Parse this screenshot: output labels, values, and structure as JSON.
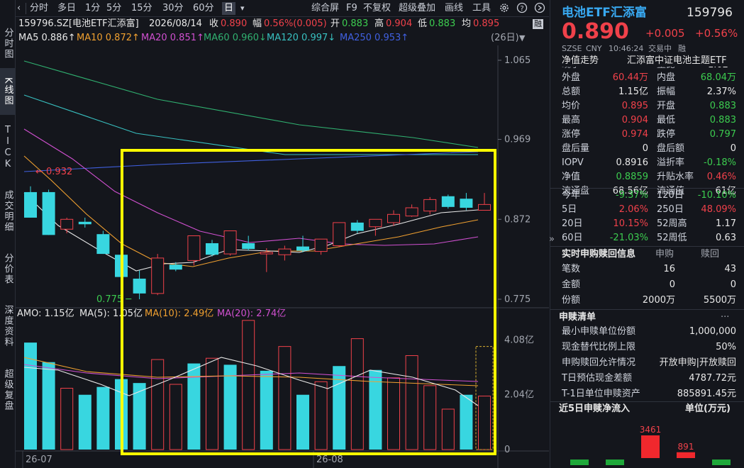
{
  "left_tabs": [
    "分时图",
    "K线图",
    "TICK",
    "成交明细",
    "分价表",
    "深度资料",
    "超级复盘"
  ],
  "toolbar": {
    "nav_left": "‹",
    "nav_right": "›",
    "periods": [
      "分时",
      "多日",
      "1分",
      "5分",
      "15分",
      "30分",
      "60分",
      "日"
    ],
    "period_dropdown": "▾",
    "actions": [
      "综合屏",
      "F9",
      "不复权",
      "超级叠加",
      "画线",
      "工具"
    ],
    "icons": [
      "gear-icon",
      "help-icon",
      "collapse-icon"
    ]
  },
  "info": {
    "symbol": "159796.SZ[电池ETF汇添富]",
    "date": "2026/08/14",
    "close_label": "收",
    "close": "0.890",
    "change_label": "幅",
    "change": "0.56%(0.005)",
    "open_label": "开",
    "open": "0.883",
    "high_label": "高",
    "high": "0.904",
    "low_label": "低",
    "low": "0.883",
    "avg_label": "均",
    "avg": "0.895",
    "badge": "融"
  },
  "ma": {
    "ma5": "MA5 0.886↑",
    "ma10": "MA10 0.872↑",
    "ma20": "MA20 0.851↑",
    "ma60": "MA60 0.960↓",
    "ma120": "MA120 0.997↓",
    "ma250": "MA250 0.953↑",
    "range": "(26日)"
  },
  "colors": {
    "up": "#f0414a",
    "down": "#38d6e0",
    "ma5": "#e8e8e8",
    "ma10": "#f0a030",
    "ma20": "#d050d0",
    "ma60": "#30b070",
    "ma120": "#38c0c0",
    "ma250": "#4060e0",
    "highlight": "#ffff00"
  },
  "chart_data": {
    "type": "candlestick",
    "price_ticks": [
      "1.065",
      "0.969",
      "0.872",
      "0.775"
    ],
    "volume_ticks": [
      "4.08亿",
      "2.04亿",
      "0"
    ],
    "x_ticks": [
      "26-07",
      "26-08"
    ],
    "annotations": {
      "high_mark": "0.932",
      "low_mark": "0.775"
    },
    "candles": [
      {
        "o": 0.905,
        "h": 0.912,
        "l": 0.874,
        "c": 0.874
      },
      {
        "o": 0.905,
        "h": 0.908,
        "l": 0.853,
        "c": 0.853
      },
      {
        "o": 0.86,
        "h": 0.874,
        "l": 0.855,
        "c": 0.872
      },
      {
        "o": 0.869,
        "h": 0.874,
        "l": 0.862,
        "c": 0.866
      },
      {
        "o": 0.854,
        "h": 0.858,
        "l": 0.83,
        "c": 0.83
      },
      {
        "o": 0.829,
        "h": 0.835,
        "l": 0.802,
        "c": 0.802
      },
      {
        "o": 0.8,
        "h": 0.81,
        "l": 0.775,
        "c": 0.782
      },
      {
        "o": 0.782,
        "h": 0.83,
        "l": 0.78,
        "c": 0.825
      },
      {
        "o": 0.817,
        "h": 0.82,
        "l": 0.809,
        "c": 0.811
      },
      {
        "o": 0.822,
        "h": 0.852,
        "l": 0.816,
        "c": 0.852
      },
      {
        "o": 0.843,
        "h": 0.847,
        "l": 0.827,
        "c": 0.829
      },
      {
        "o": 0.83,
        "h": 0.858,
        "l": 0.828,
        "c": 0.858
      },
      {
        "o": 0.843,
        "h": 0.852,
        "l": 0.834,
        "c": 0.836
      },
      {
        "o": 0.83,
        "h": 0.837,
        "l": 0.808,
        "c": 0.832
      },
      {
        "o": 0.829,
        "h": 0.84,
        "l": 0.822,
        "c": 0.836
      },
      {
        "o": 0.839,
        "h": 0.852,
        "l": 0.832,
        "c": 0.834
      },
      {
        "o": 0.833,
        "h": 0.848,
        "l": 0.829,
        "c": 0.848
      },
      {
        "o": 0.84,
        "h": 0.868,
        "l": 0.838,
        "c": 0.868
      },
      {
        "o": 0.868,
        "h": 0.871,
        "l": 0.855,
        "c": 0.858
      },
      {
        "o": 0.863,
        "h": 0.872,
        "l": 0.852,
        "c": 0.872
      },
      {
        "o": 0.868,
        "h": 0.883,
        "l": 0.864,
        "c": 0.878
      },
      {
        "o": 0.876,
        "h": 0.89,
        "l": 0.875,
        "c": 0.886
      },
      {
        "o": 0.882,
        "h": 0.899,
        "l": 0.878,
        "c": 0.896
      },
      {
        "o": 0.9,
        "h": 0.902,
        "l": 0.885,
        "c": 0.887
      },
      {
        "o": 0.897,
        "h": 0.904,
        "l": 0.883,
        "c": 0.886
      },
      {
        "o": 0.883,
        "h": 0.904,
        "l": 0.883,
        "c": 0.89
      }
    ],
    "volumes": [
      {
        "v": 4.1,
        "up": false
      },
      {
        "v": 3.35,
        "up": false
      },
      {
        "v": 2.35,
        "up": true
      },
      {
        "v": 2.1,
        "up": false
      },
      {
        "v": 2.4,
        "up": false
      },
      {
        "v": 2.7,
        "up": false
      },
      {
        "v": 2.55,
        "up": false
      },
      {
        "v": 3.45,
        "up": true
      },
      {
        "v": 2.5,
        "up": true
      },
      {
        "v": 3.3,
        "up": false
      },
      {
        "v": 3.5,
        "up": true
      },
      {
        "v": 3.25,
        "up": false
      },
      {
        "v": 4.95,
        "up": true
      },
      {
        "v": 3.02,
        "up": false
      },
      {
        "v": 3.95,
        "up": true
      },
      {
        "v": 2.1,
        "up": false
      },
      {
        "v": 2.6,
        "up": true
      },
      {
        "v": 3.2,
        "up": false
      },
      {
        "v": 4.25,
        "up": true
      },
      {
        "v": 3.05,
        "up": false
      },
      {
        "v": 2.75,
        "up": true
      },
      {
        "v": 3.6,
        "up": true
      },
      {
        "v": 2.45,
        "up": true
      },
      {
        "v": 1.55,
        "up": true
      },
      {
        "v": 2.1,
        "up": false
      },
      {
        "v": 2.05,
        "up": true
      }
    ],
    "volume_max": 5.0,
    "amo": {
      "label": "AMO: 1.15亿",
      "ma5": "MA(5): 1.05亿",
      "ma10": "MA(10): 2.49亿",
      "ma20": "MA(20): 2.74亿"
    }
  },
  "right": {
    "title": "电池ETF汇添富",
    "code": "159796",
    "price": "0.890",
    "chg": "+0.005",
    "chg_pct": "+0.56%",
    "sub": {
      "exchange": "SZSE",
      "currency": "CNY",
      "time": "10:46:24",
      "status": "交易中",
      "badge": "融"
    },
    "nav_trend": "净值走势",
    "fund_name": "汇添富中证电池主题ETF",
    "partial": {
      "k1": "现手",
      "k2": "量比",
      "v2": "1.02"
    },
    "quote": [
      {
        "k1": "外盘",
        "v1": "60.44万",
        "c1": "red",
        "k2": "内盘",
        "v2": "68.04万",
        "c2": "green"
      },
      {
        "k1": "总额",
        "v1": "1.15亿",
        "c1": "white",
        "k2": "振幅",
        "v2": "2.37%",
        "c2": "white"
      },
      {
        "k1": "均价",
        "v1": "0.895",
        "c1": "red",
        "k2": "开盘",
        "v2": "0.883",
        "c2": "green"
      },
      {
        "k1": "最高",
        "v1": "0.904",
        "c1": "red",
        "k2": "最低",
        "v2": "0.883",
        "c2": "green"
      },
      {
        "k1": "涨停",
        "v1": "0.974",
        "c1": "red",
        "k2": "跌停",
        "v2": "0.797",
        "c2": "green"
      },
      {
        "k1": "盘后量",
        "v1": "0",
        "c1": "white",
        "k2": "盘后额",
        "v2": "0",
        "c2": "white"
      },
      {
        "k1": "IOPV",
        "v1": "0.8916",
        "c1": "white",
        "k2": "溢折率",
        "v2": "-0.18%",
        "c2": "green"
      },
      {
        "k1": "净值",
        "v1": "0.8859",
        "c1": "green",
        "k2": "升贴水率",
        "v2": "0.46%",
        "c2": "red"
      },
      {
        "k1": "流通盘",
        "v1": "68.56亿",
        "c1": "white",
        "k2": "流通值",
        "v2": "61亿",
        "c2": "white"
      }
    ],
    "perf": [
      {
        "k1": "今年",
        "v1": "-9.37%",
        "c1": "green",
        "k2": "120日",
        "v2": "-10.10%",
        "c2": "green"
      },
      {
        "k1": "5日",
        "v1": "2.06%",
        "c1": "red",
        "k2": "250日",
        "v2": "48.09%",
        "c2": "red"
      },
      {
        "k1": "20日",
        "v1": "10.15%",
        "c1": "red",
        "k2": "52周高",
        "v2": "1.17",
        "c2": "white"
      },
      {
        "k1": "60日",
        "v1": "-21.03%",
        "c1": "green",
        "k2": "52周低",
        "v2": "0.63",
        "c2": "white"
      }
    ],
    "sub_title": "实时申购赎回信息",
    "sub_h1": "申购",
    "sub_h2": "赎回",
    "sub_rows": [
      {
        "k": "笔数",
        "a": "16",
        "b": "43"
      },
      {
        "k": "金额",
        "a": "0",
        "b": "0"
      },
      {
        "k": "份额",
        "a": "2000万",
        "b": "5500万"
      }
    ],
    "list_title": "申赎清单",
    "list_more": "···",
    "list_rows": [
      {
        "k": "最小申赎单位份额",
        "v": "1,000,000"
      },
      {
        "k": "现金替代比例上限",
        "v": "50%"
      },
      {
        "k": "申购赎回允许情况",
        "v": "开放申购|开放赎回"
      },
      {
        "k": "T日预估现金差额",
        "v": "4787.72元"
      },
      {
        "k": "T-1日单位申赎资产",
        "v": "885891.45元"
      }
    ],
    "flow_title": "近5日申赎净流入",
    "flow_unit": "单位(万元)",
    "flow_bars": [
      {
        "label": "",
        "v": -200
      },
      {
        "label": "",
        "v": -200
      },
      {
        "label": "3461",
        "v": 3461
      },
      {
        "label": "891",
        "v": 891
      },
      {
        "label": "",
        "v": -200
      }
    ],
    "expand": "»"
  }
}
